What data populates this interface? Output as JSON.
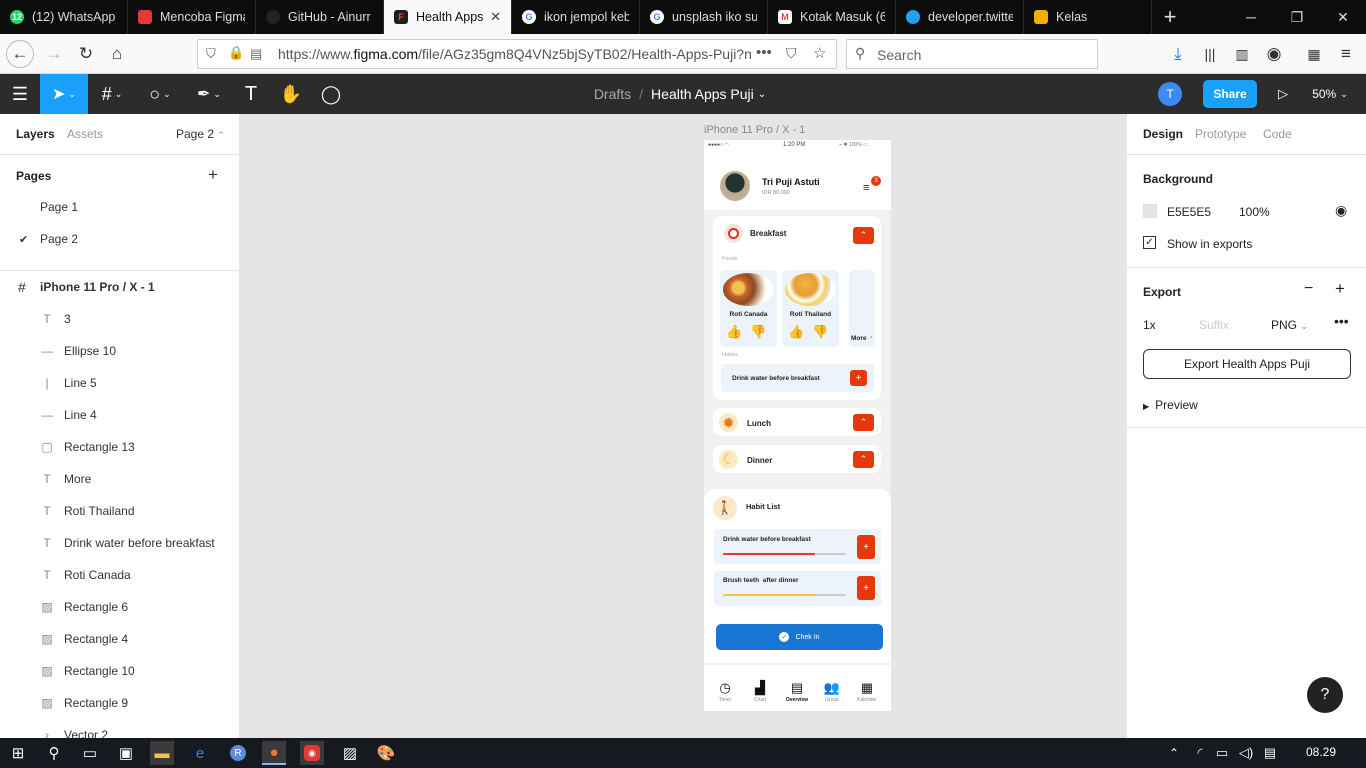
{
  "browser": {
    "tabs": [
      {
        "label": "(12) WhatsApp",
        "favicon": "whatsapp-icon",
        "color": "#25d366"
      },
      {
        "label": "Mencoba Figma",
        "favicon": "slides-icon",
        "color": "#e53935"
      },
      {
        "label": "GitHub - Ainurr",
        "favicon": "github-icon",
        "color": "#222222"
      },
      {
        "label": "Health Apps",
        "favicon": "figma-icon",
        "color": "#000000",
        "active": true
      },
      {
        "label": "ikon jempol keb",
        "favicon": "google-icon",
        "color": "#4285f4"
      },
      {
        "label": "unsplash iko suk",
        "favicon": "google-icon",
        "color": "#4285f4"
      },
      {
        "label": "Kotak Masuk (67",
        "favicon": "gmail-icon",
        "color": "#ea4335"
      },
      {
        "label": "developer.twitte",
        "favicon": "twitter-icon",
        "color": "#1da1f2"
      },
      {
        "label": "Kelas",
        "favicon": "classroom-icon",
        "color": "#1e8e3e"
      }
    ],
    "url_prefix": "https://www.",
    "url_domain": "figma.com",
    "url_rest": "/file/AGz35gm8Q4VNz5bjSyTB02/Health-Apps-Puji?n",
    "search_placeholder": "Search"
  },
  "figma": {
    "breadcrumb_parent": "Drafts",
    "breadcrumb_sep": "/",
    "file_name": "Health Apps Puji",
    "avatar_letter": "T",
    "share_label": "Share",
    "zoom": "50%"
  },
  "left_panel": {
    "tab_layers": "Layers",
    "tab_assets": "Assets",
    "page_selector": "Page 2",
    "pages_title": "Pages",
    "pages": [
      "Page 1",
      "Page 2"
    ],
    "frame_name": "iPhone 11 Pro / X - 1",
    "layers": [
      {
        "name": "3",
        "icon": "text-icon"
      },
      {
        "name": "Ellipse 10",
        "icon": "line-icon"
      },
      {
        "name": "Line 5",
        "icon": "vline-icon"
      },
      {
        "name": "Line 4",
        "icon": "line-icon"
      },
      {
        "name": "Rectangle 13",
        "icon": "rect-icon"
      },
      {
        "name": "More",
        "icon": "text-icon"
      },
      {
        "name": "Roti Thailand",
        "icon": "text-icon"
      },
      {
        "name": "Drink water before breakfast",
        "icon": "text-icon"
      },
      {
        "name": "Roti Canada",
        "icon": "text-icon"
      },
      {
        "name": "Rectangle 6",
        "icon": "image-icon"
      },
      {
        "name": "Rectangle 4",
        "icon": "image-icon"
      },
      {
        "name": "Rectangle 10",
        "icon": "image-icon"
      },
      {
        "name": "Rectangle 9",
        "icon": "image-icon"
      },
      {
        "name": "Vector 2",
        "icon": "vector-icon"
      }
    ]
  },
  "right_panel": {
    "tabs": [
      "Design",
      "Prototype",
      "Code"
    ],
    "background_title": "Background",
    "bg_hex": "E5E5E5",
    "bg_opacity": "100%",
    "show_in_exports": "Show in exports",
    "export_title": "Export",
    "export_scale": "1x",
    "export_suffix_placeholder": "Suffix",
    "export_format": "PNG",
    "export_button": "Export Health Apps Puji",
    "preview_label": "Preview"
  },
  "canvas": {
    "frame_label": "iPhone 11 Pro / X - 1"
  },
  "phone": {
    "status_time": "1:20 PM",
    "status_battery": "100%",
    "user_name": "Tri Puji Astuti",
    "balance": "IDR 80.000",
    "notif_count": "3",
    "breakfast": "Breakfast",
    "foods_label": "Foods",
    "food1": "Roti Canada",
    "food2": "Roti Thailand",
    "more": "More",
    "habits_label": "Habits",
    "habit_item": "Drink water before breakfast",
    "lunch": "Lunch",
    "dinner": "Dinner",
    "habit_list": "Habit List",
    "hl1": "Drink water before breakfast",
    "hl1_progress": 0.75,
    "hl2": "Brush teeth  after dinner",
    "hl2_progress": 0.75,
    "checkin": "Chek In",
    "nav": [
      "Timer",
      "Chart",
      "Overview",
      "Group",
      "Kalender"
    ],
    "accent": "#e5390b",
    "blue": "#1976d2"
  },
  "taskbar": {
    "time": "08.29"
  }
}
